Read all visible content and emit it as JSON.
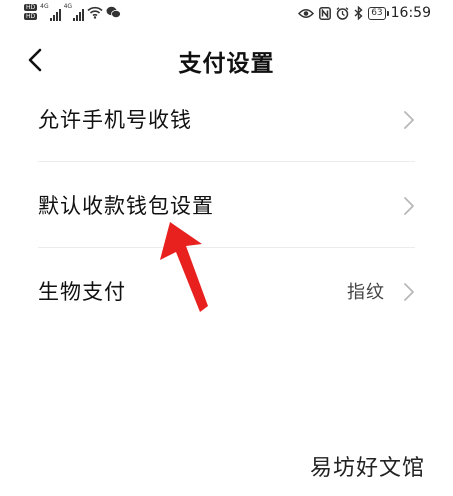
{
  "status_bar": {
    "network_badges": [
      "HD",
      "HD"
    ],
    "signal_labels": [
      "4G",
      "4G"
    ],
    "battery": "63",
    "time": "16:59",
    "icons": [
      "eye-icon",
      "nfc-icon",
      "alarm-icon",
      "bluetooth-icon",
      "wifi-icon",
      "wechat-icon"
    ]
  },
  "nav": {
    "title": "支付设置",
    "back_icon": "chevron-left-icon"
  },
  "rows": [
    {
      "label": "允许手机号收钱",
      "value": ""
    },
    {
      "label": "默认收款钱包设置",
      "value": ""
    },
    {
      "label": "生物支付",
      "value": "指纹"
    }
  ],
  "annotation": {
    "color": "#e8211f"
  },
  "watermark": "易坊好文馆",
  "colors": {
    "background": "#ffffff",
    "text": "#111111",
    "divider": "#ececec",
    "chevron": "#b8b8b8"
  }
}
